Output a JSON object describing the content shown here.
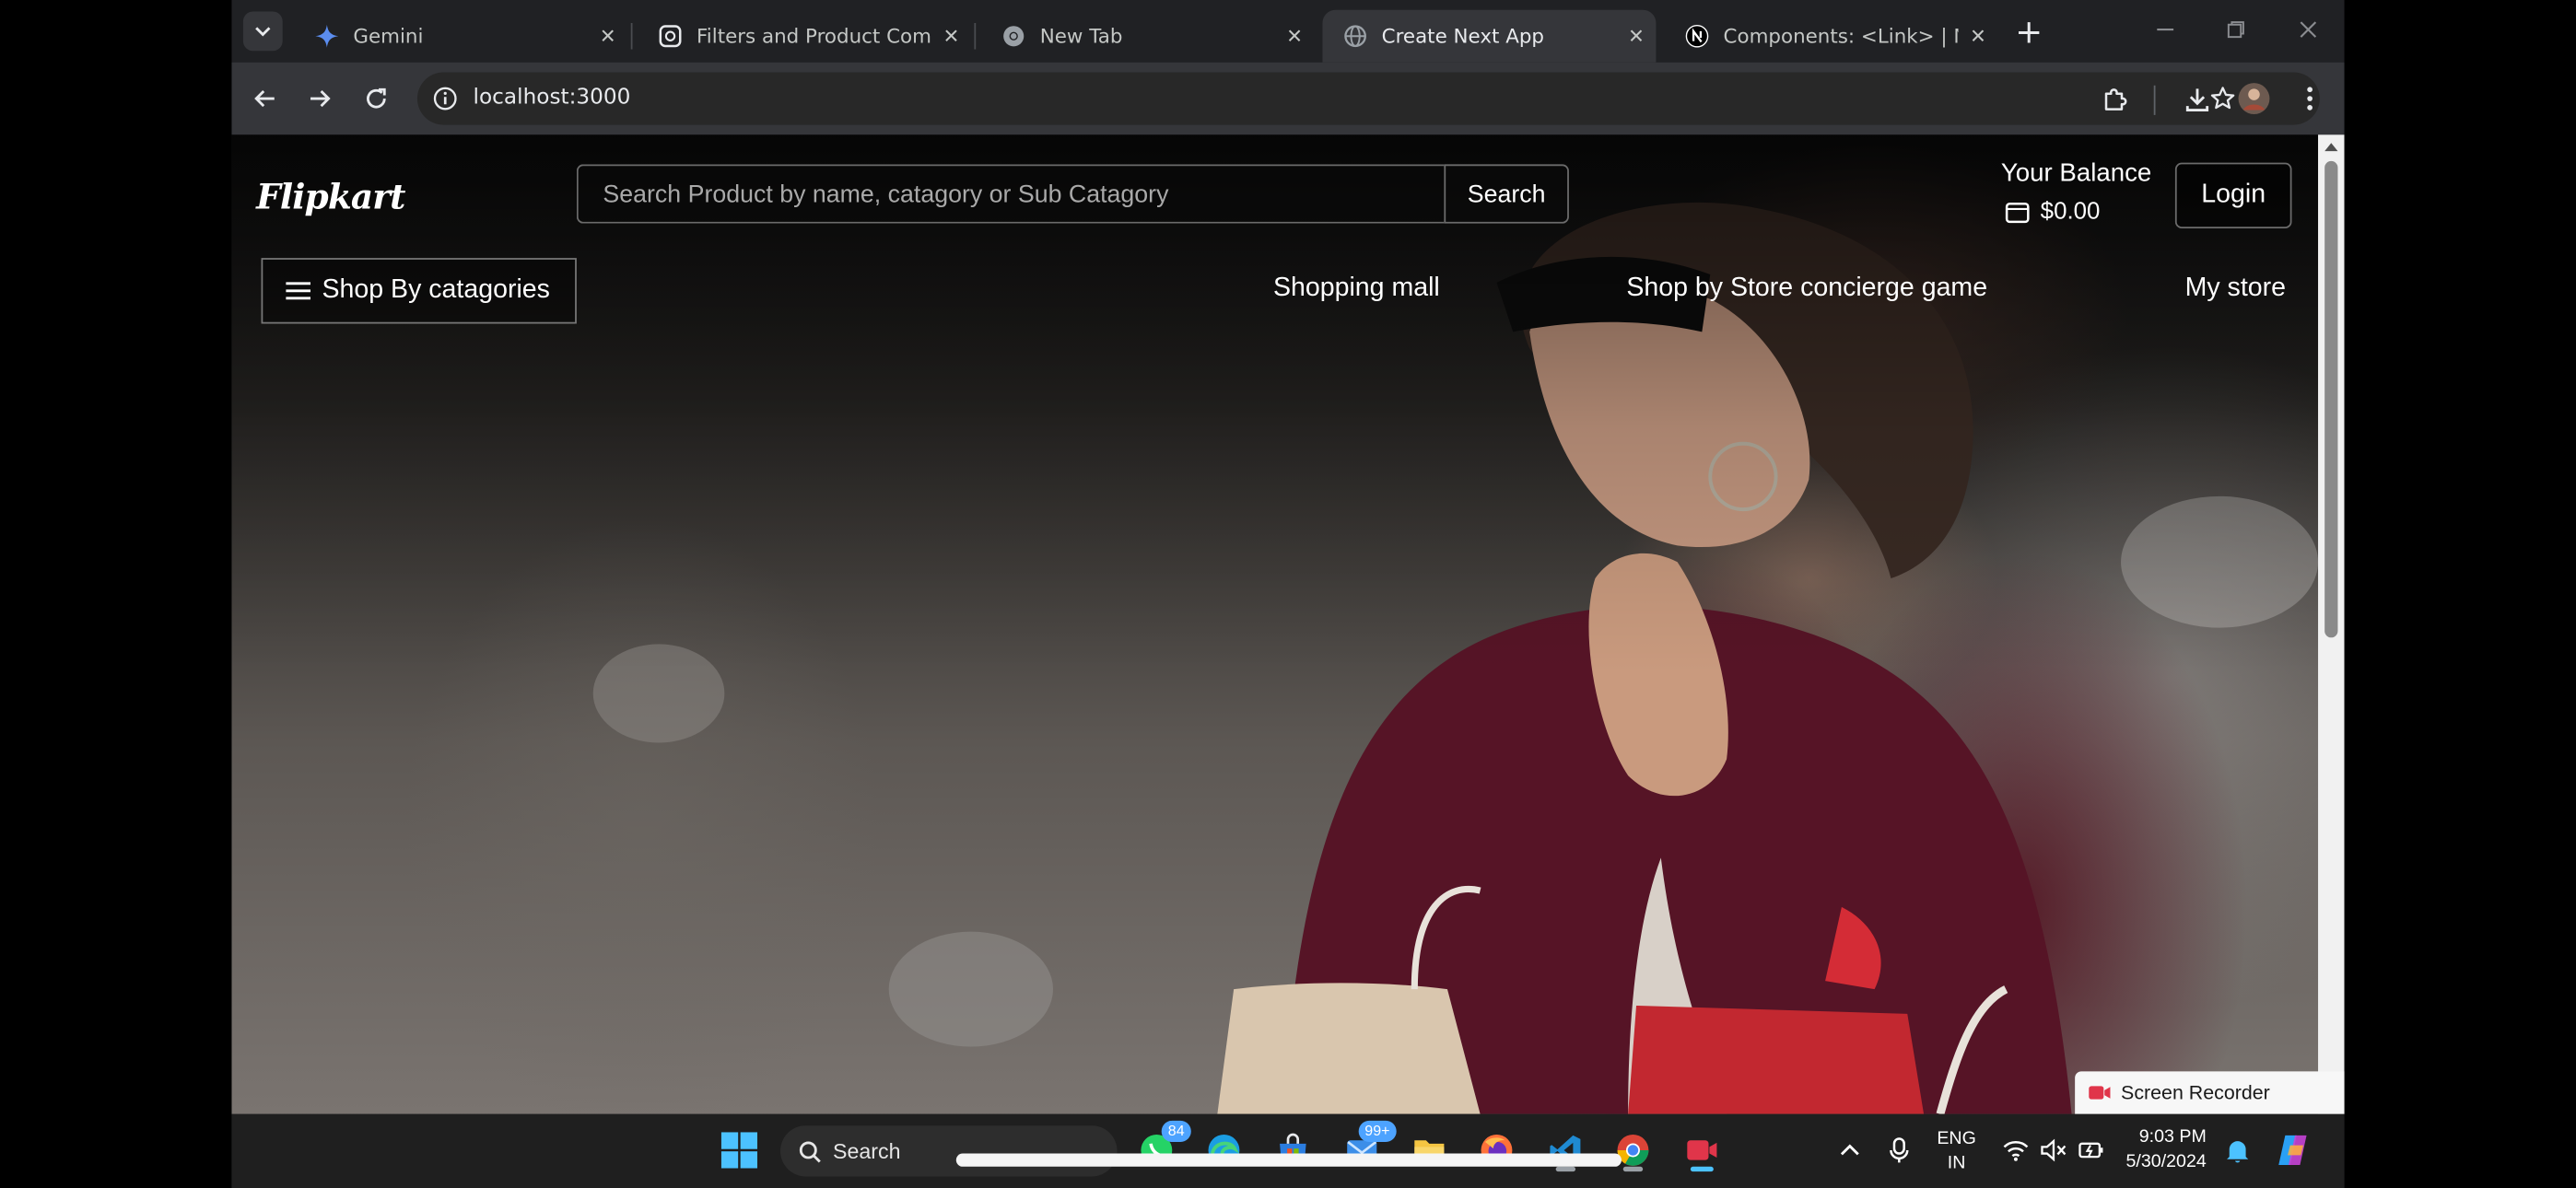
{
  "browser": {
    "tabs": [
      {
        "title": "Gemini",
        "icon": "gemini-icon",
        "active": false
      },
      {
        "title": "Filters and Product Compone",
        "icon": "openai-icon",
        "active": false
      },
      {
        "title": "New Tab",
        "icon": "chrome-icon",
        "active": false
      },
      {
        "title": "Create Next App",
        "icon": "globe-icon",
        "active": true
      },
      {
        "title": "Components: <Link> | Next.",
        "icon": "nextjs-icon",
        "active": false
      }
    ],
    "close_glyph": "✕",
    "new_tab_glyph": "+",
    "url": "localhost:3000"
  },
  "page": {
    "logo": "Flipkart",
    "search": {
      "placeholder": "Search Product by name, catagory or Sub Catagory",
      "value": "",
      "button": "Search"
    },
    "balance": {
      "label": "Your Balance",
      "amount": "$0.00"
    },
    "login": "Login",
    "categories_button": "Shop By catagories",
    "nav": [
      "Shopping mall",
      "Shop by Store concierge game",
      "My store"
    ]
  },
  "recorder": {
    "label": "Screen Recorder"
  },
  "taskbar": {
    "search": "Search",
    "whatsapp_badge": "84",
    "mail_badge": "99+",
    "lang": {
      "line1": "ENG",
      "line2": "IN"
    },
    "clock": {
      "time": "9:03 PM",
      "date": "5/30/2024"
    }
  },
  "colors": {
    "accent_blue": "#4cc2ff",
    "chrome_dark": "#202124",
    "toolbar": "#35363a"
  }
}
